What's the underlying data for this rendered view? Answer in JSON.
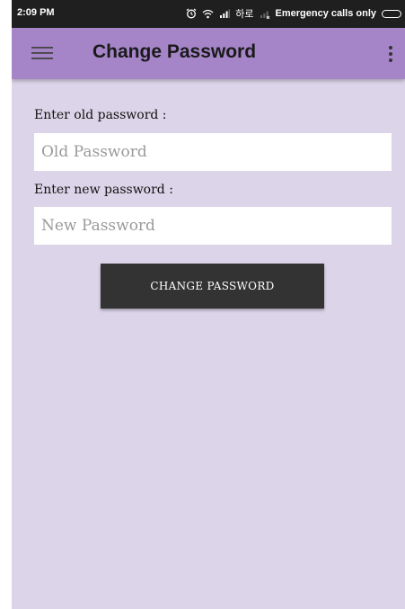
{
  "status_bar": {
    "time": "2:09 PM",
    "carrier_text": "하로",
    "emergency_text": "Emergency calls only",
    "icons": [
      "alarm-icon",
      "wifi-icon",
      "signal-icon",
      "no-signal-icon",
      "battery-icon"
    ]
  },
  "app_bar": {
    "title": "Change Password",
    "color": "#a585c8",
    "icons": [
      "menu-icon",
      "overflow-menu-icon"
    ]
  },
  "form": {
    "old_label": "Enter old password :",
    "old_placeholder": "Old Password",
    "old_value": "",
    "new_label": "Enter new password :",
    "new_placeholder": "New Password",
    "new_value": "",
    "submit_label": "CHANGE PASSWORD"
  },
  "colors": {
    "background": "#dcd4e8",
    "button": "#333333",
    "status_bar": "#1f1f1f"
  }
}
